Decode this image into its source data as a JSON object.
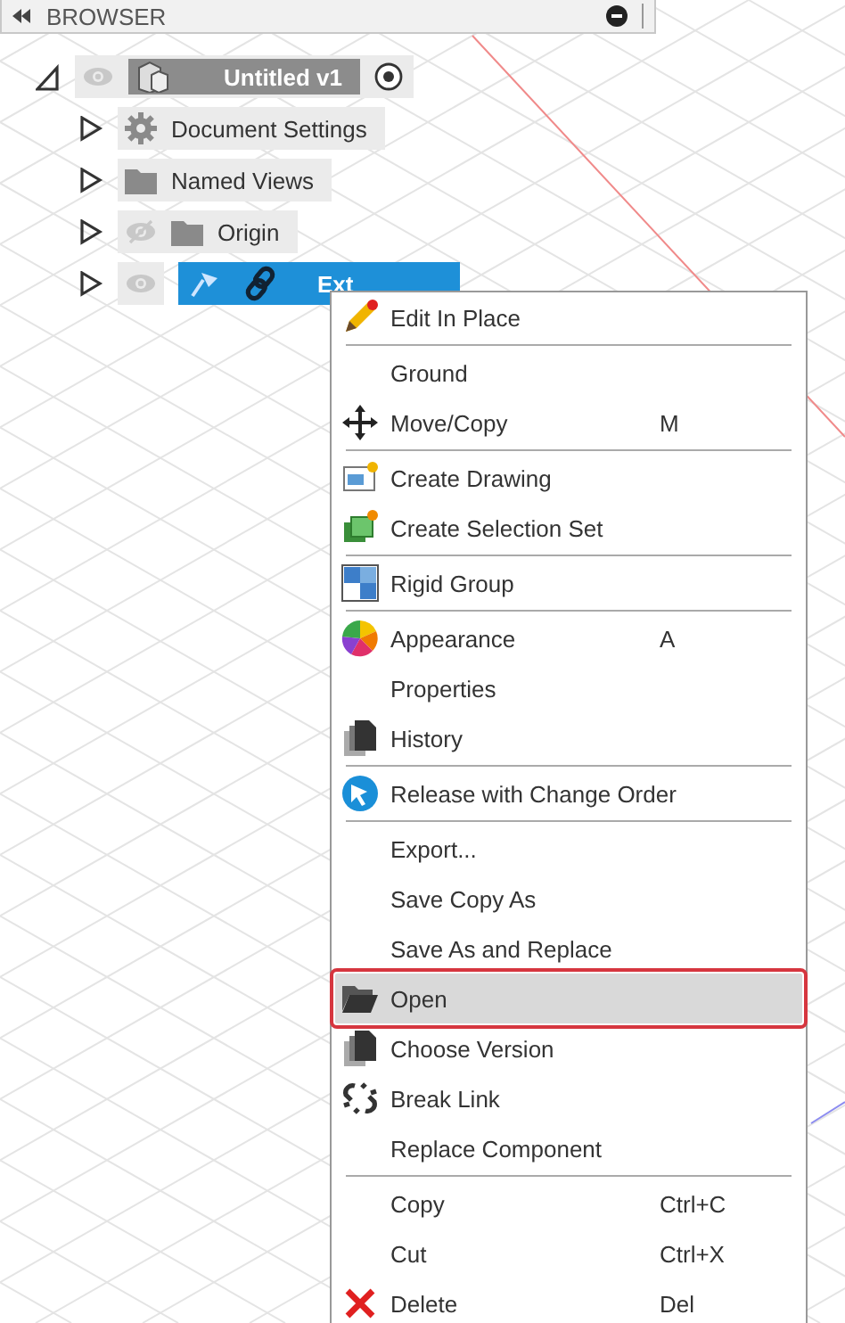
{
  "browser": {
    "title": "BROWSER"
  },
  "tree": {
    "label": "Untitled v1",
    "expanded": true,
    "visible": true,
    "children": [
      {
        "label": "Document Settings",
        "kind": "settings",
        "expanded": false,
        "selected": false
      },
      {
        "label": "Named Views",
        "kind": "folder",
        "expanded": false,
        "selected": false
      },
      {
        "label": "Origin",
        "kind": "folder",
        "expanded": false,
        "visible": false,
        "selected": false
      },
      {
        "label": "Ext",
        "kind": "link",
        "expanded": false,
        "visible": true,
        "selected": true
      }
    ]
  },
  "menu": {
    "items": [
      {
        "label": "Edit In Place",
        "kind": "pencil",
        "separator_after": true,
        "selected": false
      },
      {
        "label": "Ground",
        "kind": "plain",
        "separator_after": false,
        "selected": false
      },
      {
        "label": "Move/Copy",
        "kind": "move",
        "shortcut": "M",
        "separator_after": true,
        "selected": false
      },
      {
        "label": "Create Drawing",
        "kind": "drawing",
        "separator_after": false,
        "selected": false
      },
      {
        "label": "Create Selection Set",
        "kind": "selset",
        "separator_after": true,
        "selected": false
      },
      {
        "label": "Rigid Group",
        "kind": "rigid",
        "separator_after": true,
        "selected": false
      },
      {
        "label": "Appearance",
        "kind": "appearance",
        "shortcut": "A",
        "separator_after": false,
        "selected": false
      },
      {
        "label": "Properties",
        "kind": "plain",
        "separator_after": false,
        "selected": false
      },
      {
        "label": "History",
        "kind": "pages",
        "separator_after": true,
        "selected": false
      },
      {
        "label": "Release with Change Order",
        "kind": "release",
        "separator_after": true,
        "selected": false
      },
      {
        "label": "Export...",
        "kind": "plain",
        "separator_after": false,
        "selected": false
      },
      {
        "label": "Save Copy As",
        "kind": "plain",
        "separator_after": false,
        "selected": false
      },
      {
        "label": "Save As and Replace",
        "kind": "plain",
        "separator_after": false,
        "selected": false
      },
      {
        "label": "Open",
        "kind": "openfolder",
        "separator_after": false,
        "selected": true
      },
      {
        "label": "Choose Version",
        "kind": "pages",
        "separator_after": false,
        "selected": false
      },
      {
        "label": "Break Link",
        "kind": "breaklink",
        "separator_after": false,
        "selected": false
      },
      {
        "label": "Replace Component",
        "kind": "plain",
        "separator_after": true,
        "selected": false
      },
      {
        "label": "Copy",
        "kind": "plain",
        "shortcut": "Ctrl+C",
        "separator_after": false,
        "selected": false
      },
      {
        "label": "Cut",
        "kind": "plain",
        "shortcut": "Ctrl+X",
        "separator_after": false,
        "selected": false
      },
      {
        "label": "Delete",
        "kind": "delete",
        "shortcut": "Del",
        "separator_after": false,
        "selected": false
      }
    ]
  }
}
